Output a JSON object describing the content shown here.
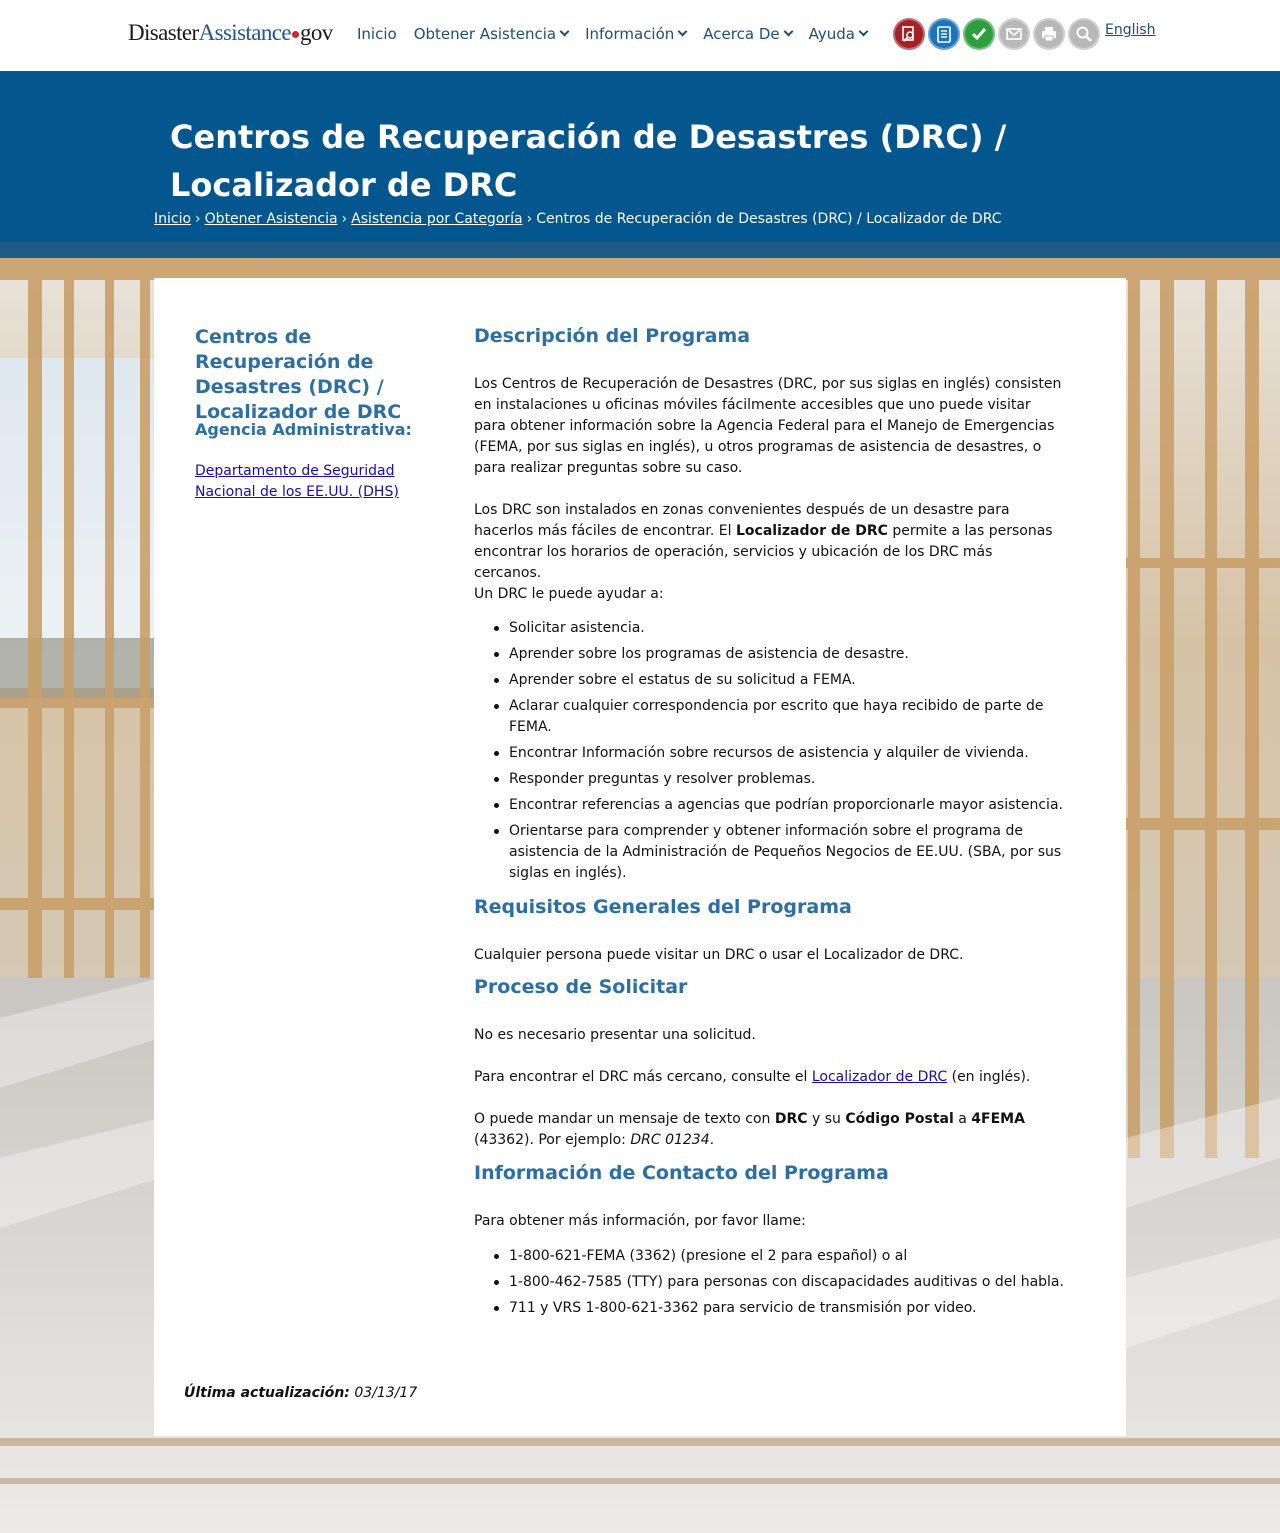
{
  "header": {
    "logo": {
      "part1": "Disaster",
      "part2": "Assistance",
      "part3": "gov"
    },
    "nav": [
      {
        "label": "Inicio",
        "dropdown": false
      },
      {
        "label": "Obtener Asistencia",
        "dropdown": true
      },
      {
        "label": "Información",
        "dropdown": true
      },
      {
        "label": "Acerca De",
        "dropdown": true
      },
      {
        "label": "Ayuda",
        "dropdown": true
      }
    ],
    "tools": [
      {
        "icon": "search-document-icon",
        "color": "#a32127"
      },
      {
        "icon": "checklist-icon",
        "color": "#1b75bb"
      },
      {
        "icon": "checkmark-icon",
        "color": "#2e9e3e"
      },
      {
        "icon": "mail-icon",
        "color": "#b8b8b8"
      },
      {
        "icon": "print-icon",
        "color": "#b8b8b8"
      },
      {
        "icon": "magnifier-icon",
        "color": "#b8b8b8"
      }
    ],
    "language": "English"
  },
  "banner": {
    "title": "Centros de Recuperación de Desastres (DRC) / Localizador de DRC",
    "breadcrumb": {
      "links": [
        "Inicio",
        "Obtener Asistencia",
        "Asistencia por Categoría"
      ],
      "current": "Centros de Recuperación de Desastres (DRC) / Localizador de DRC"
    },
    "color": "#04568e"
  },
  "sidebar": {
    "title": "Centros de Recuperación de Desastres (DRC) / Localizador de DRC",
    "agency_heading": "Agencia Administrativa:",
    "agency_link": "Departamento de Seguridad Nacional de los EE.UU. (DHS)"
  },
  "main": {
    "h_description": "Descripción del Programa",
    "p1": "Los Centros de Recuperación de Desastres (DRC, por sus siglas en inglés) consisten en instalaciones u oficinas móviles fácilmente accesibles que uno puede visitar para obtener información sobre la Agencia Federal para el Manejo de Emergencias (FEMA, por sus siglas en inglés), u otros programas de asistencia de desastres, o para realizar preguntas sobre su caso.",
    "p2_a": "Los DRC son instalados en zonas convenientes después de un desastre para hacerlos más fáciles de encontrar. El ",
    "p2_bold": "Localizador de DRC",
    "p2_b": " permite a las personas encontrar los horarios de operación, servicios y ubicación de los DRC más cercanos.",
    "p3": "Un DRC le puede ayudar a:",
    "help_list": [
      "Solicitar asistencia.",
      "Aprender sobre los programas de asistencia de desastre.",
      "Aprender sobre el estatus de su solicitud a FEMA.",
      "Aclarar cualquier correspondencia por escrito que haya recibido de parte de FEMA.",
      "Encontrar Información sobre recursos de asistencia y alquiler de vivienda.",
      "Responder preguntas y resolver problemas.",
      "Encontrar referencias a agencias que podrían proporcionarle mayor asistencia.",
      "Orientarse para comprender y obtener información sobre el programa de asistencia de la Administración de Pequeños Negocios de EE.UU. (SBA, por sus siglas en inglés)."
    ],
    "h_requirements": "Requisitos Generales del Programa",
    "req_text": "Cualquier persona puede visitar un DRC o usar el Localizador de DRC.",
    "h_process": "Proceso de Solicitar",
    "proc_p1": "No es necesario presentar una solicitud.",
    "proc_p2_a": "Para encontrar el DRC más cercano, consulte el ",
    "proc_p2_link": "Localizador de DRC",
    "proc_p2_b": " (en inglés).",
    "proc_p3_a": "O puede mandar un mensaje de texto con ",
    "proc_p3_drc": "DRC",
    "proc_p3_b": " y su ",
    "proc_p3_cp": "Código Postal",
    "proc_p3_c": " a ",
    "proc_p3_fema": "4FEMA",
    "proc_p3_d": " (43362). Por ejemplo: ",
    "proc_p3_example": "DRC 01234",
    "proc_p3_e": ".",
    "h_contact": "Información de Contacto del Programa",
    "contact_intro": "Para obtener más información, por favor llame:",
    "contact_list": [
      "1-800-621-FEMA (3362) (presione el 2 para español) o al",
      "1-800-462-7585 (TTY) para personas con discapacidades auditivas o del habla.",
      "711 y VRS 1-800-621-3362 para servicio de transmisión por video."
    ]
  },
  "footer": {
    "updated_label": "Última actualización:",
    "updated_date": "03/13/17"
  }
}
